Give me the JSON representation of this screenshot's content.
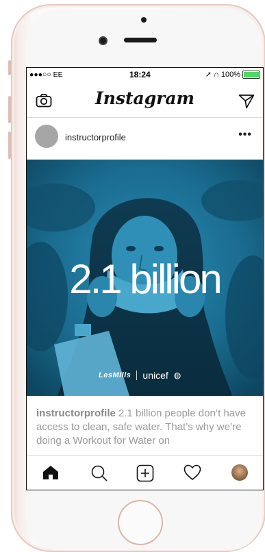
{
  "status_bar": {
    "carrier": "●●●○○ EE",
    "time": "18:24",
    "battery": "100%"
  },
  "header": {
    "logo": "Instagram",
    "left_icon": "camera-icon",
    "right_icon": "direct-message-icon"
  },
  "post": {
    "username": "instructorprofile",
    "more_label": "•••",
    "image": {
      "headline": "2.1 billion",
      "brand_left": "LesMills",
      "brand_right": "unicef"
    },
    "caption": {
      "user": "instructorprofile",
      "text": " 2.1 billion people don’t have access to clean, safe water. That’s why we’re doing a Workout for Water on"
    }
  },
  "tabbar": {
    "items": [
      "home-icon",
      "search-icon",
      "add-post-icon",
      "activity-heart-icon",
      "profile-avatar"
    ]
  },
  "colors": {
    "image_tint": "#1c6f93",
    "battery_green": "#4cd964",
    "frame_rose": "#e7c9bf"
  }
}
